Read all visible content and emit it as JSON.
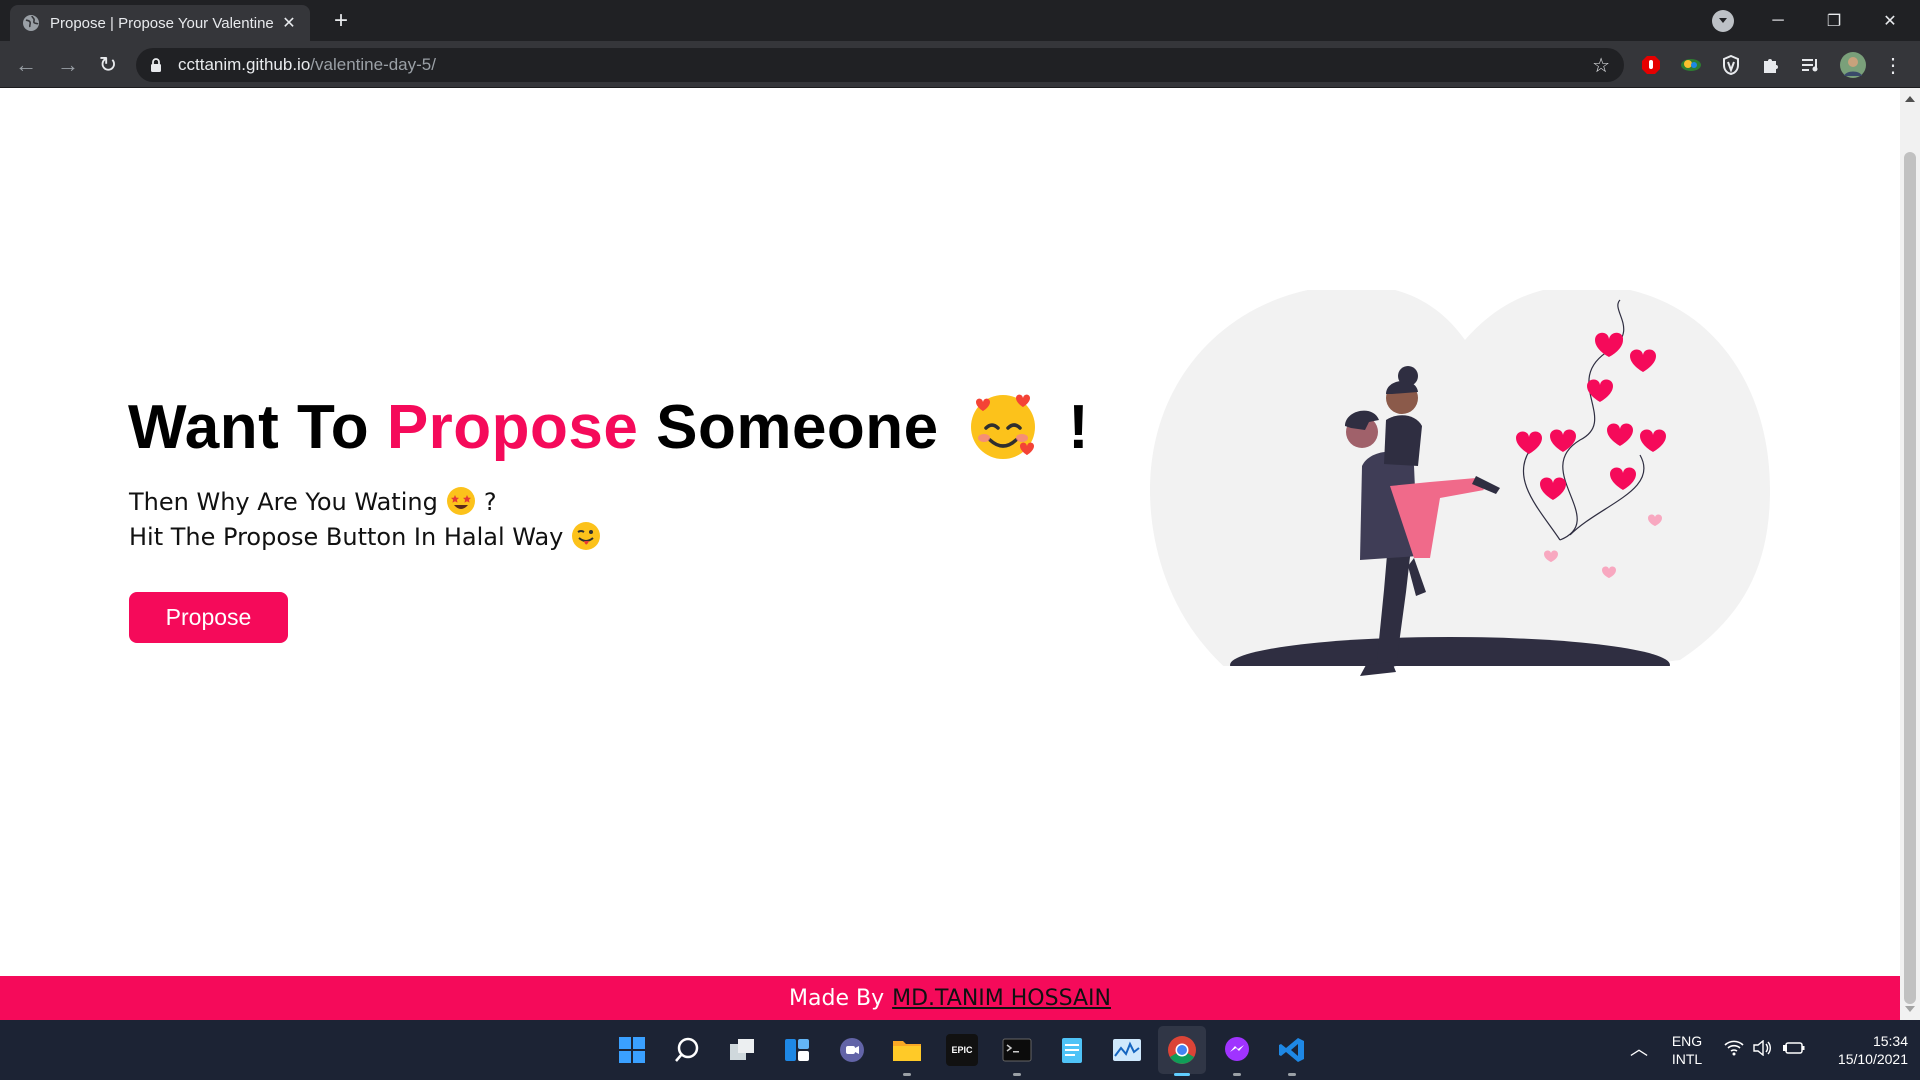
{
  "browser": {
    "tab_title": "Propose | Propose Your Valentine",
    "tab_close": "✕",
    "new_tab": "+",
    "url_host": "ccttanim.github.io",
    "url_path": "/valentine-day-5/",
    "star": "☆",
    "window_controls": {
      "minimize": "─",
      "maximize": "❐",
      "close": "✕"
    },
    "nav": {
      "back": "←",
      "forward": "→",
      "reload": "↻"
    }
  },
  "hero": {
    "title_part1": "Want To ",
    "title_accent": "Propose",
    "title_part2": " Someone",
    "title_end": "!",
    "line1_text": "Then Why Are You Wating",
    "line1_end": "?",
    "line2_text": "Hit The Propose Button In Halal Way",
    "button_label": "Propose"
  },
  "footer": {
    "made_by": "Made By",
    "author": "MD.TANIM HOSSAIN"
  },
  "taskbar": {
    "language": "ENG",
    "layout": "INTL",
    "time": "15:34",
    "date": "15/10/2021",
    "epic_label": "EPIC"
  },
  "colors": {
    "accent": "#f50a5a",
    "tabbar": "#202124",
    "toolbar": "#35363a",
    "taskbar": "#1c2334"
  }
}
